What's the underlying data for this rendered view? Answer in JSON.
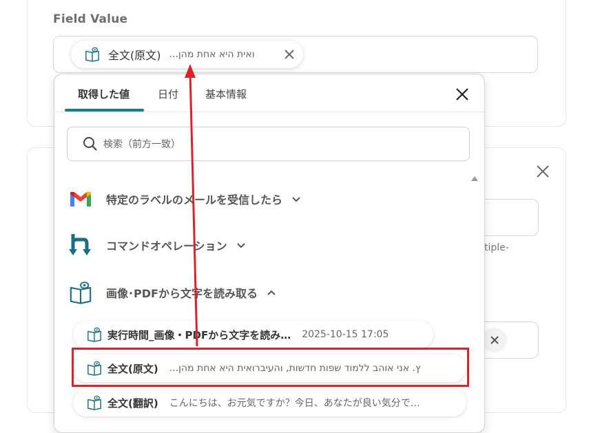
{
  "field": {
    "label": "Field Value",
    "selected_chip": {
      "name": "全文(原文)",
      "value": "...ואית היא אחת מהן",
      "icon": "ocr-book-icon"
    }
  },
  "behind": {
    "note": "tiple-"
  },
  "popup": {
    "tabs": [
      {
        "label": "取得した値",
        "active": true
      },
      {
        "label": "日付",
        "active": false
      },
      {
        "label": "基本情報",
        "active": false
      }
    ],
    "search_placeholder": "検索（前方一致）",
    "groups": [
      {
        "title": "特定のラベルのメールを受信したら",
        "icon": "gmail-icon",
        "expanded": false
      },
      {
        "title": "コマンドオペレーション",
        "icon": "command-operation-icon",
        "expanded": false
      },
      {
        "title": "画像･PDFから文字を読み取る",
        "icon": "ocr-book-icon",
        "expanded": true
      }
    ],
    "items": [
      {
        "name": "実行時間_画像・PDFから文字を読み…",
        "value": "2025-10-15 17:05"
      },
      {
        "name": "全文(原文)",
        "value": "...ץ. אני אוהב ללמוד שפות חדשות, והעיברואית היא אחת מהן"
      },
      {
        "name": "全文(翻訳)",
        "value": "こんにちは、お元気ですか？今日、あなたが良い気分で…"
      }
    ]
  },
  "colors": {
    "accent": "#1a7a8a",
    "annotation_red": "#d9232a"
  }
}
